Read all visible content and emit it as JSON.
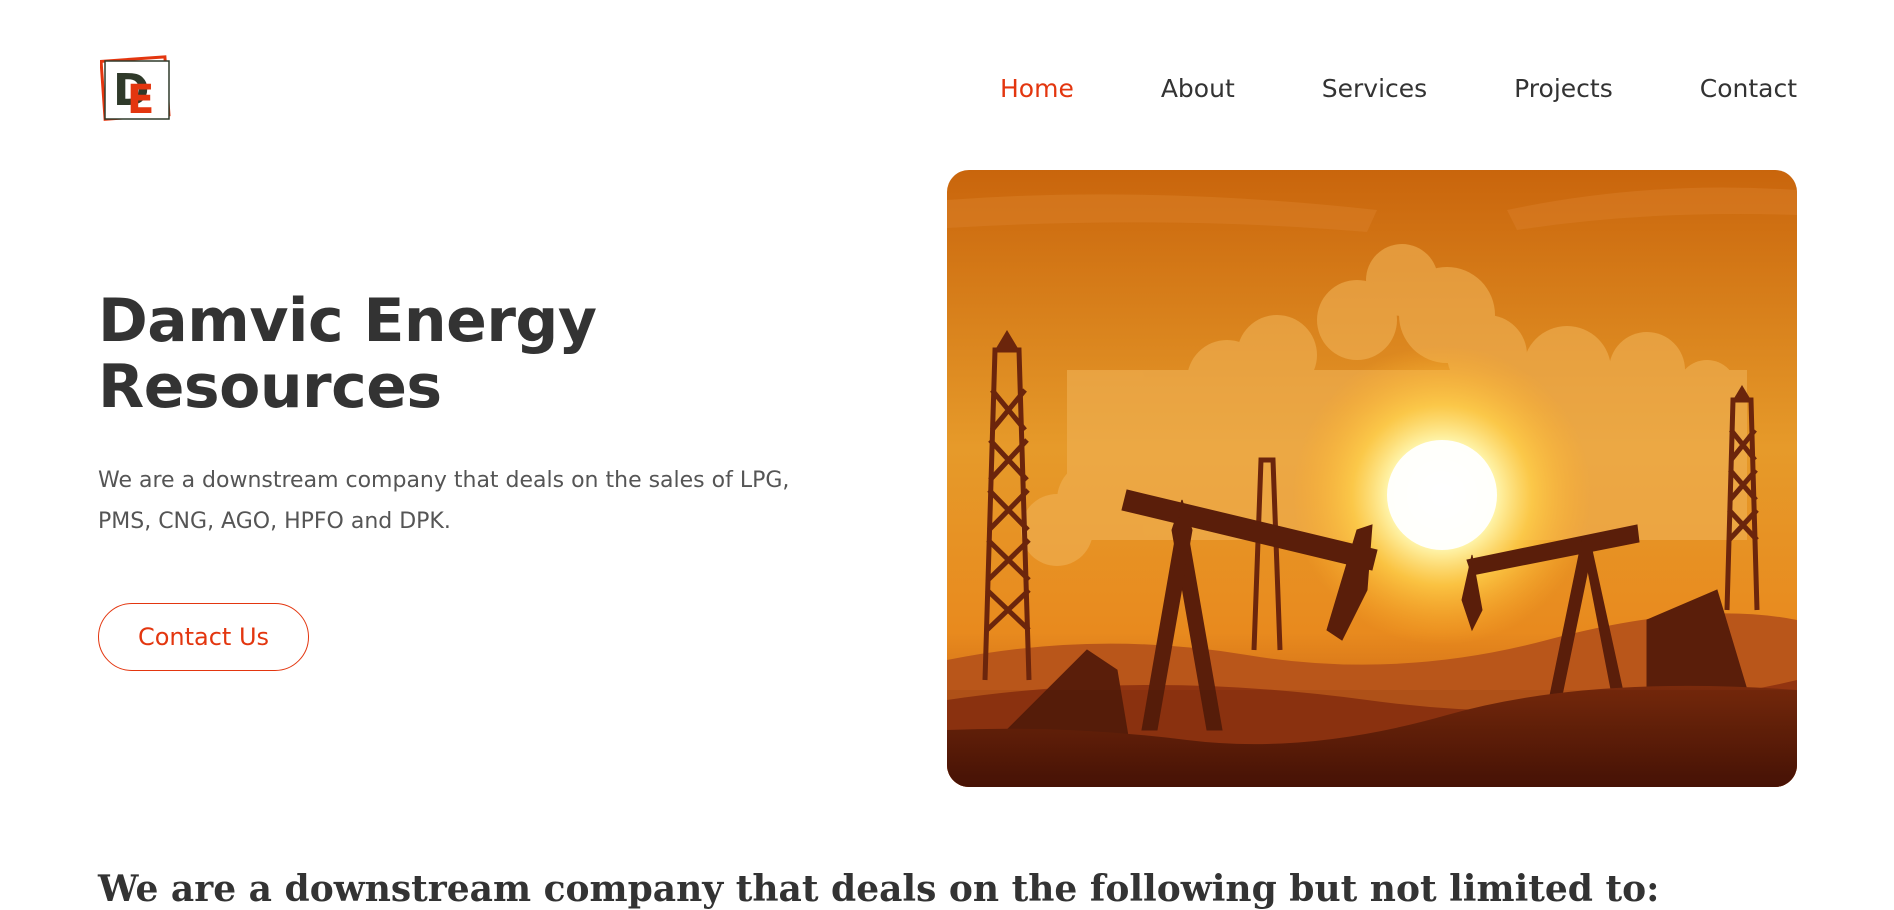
{
  "logo": {
    "letters": "DE",
    "primary": "#2f3a2a",
    "accent": "#e3360f"
  },
  "nav": {
    "items": [
      {
        "label": "Home",
        "active": true
      },
      {
        "label": "About",
        "active": false
      },
      {
        "label": "Services",
        "active": false
      },
      {
        "label": "Projects",
        "active": false
      },
      {
        "label": "Contact",
        "active": false
      }
    ]
  },
  "hero": {
    "title": "Damvic Energy Resources",
    "description": "We are a downstream company that deals on the sales of LPG, PMS, CNG, AGO, HPFO and DPK.",
    "cta_label": "Contact Us",
    "image_icon": "oil-pumpjack-sunset-illustration"
  },
  "section": {
    "heading": "We are a downstream company that deals on the following but not limited to:"
  },
  "colors": {
    "accent": "#e3360f",
    "text": "#333333",
    "muted": "#555555"
  }
}
